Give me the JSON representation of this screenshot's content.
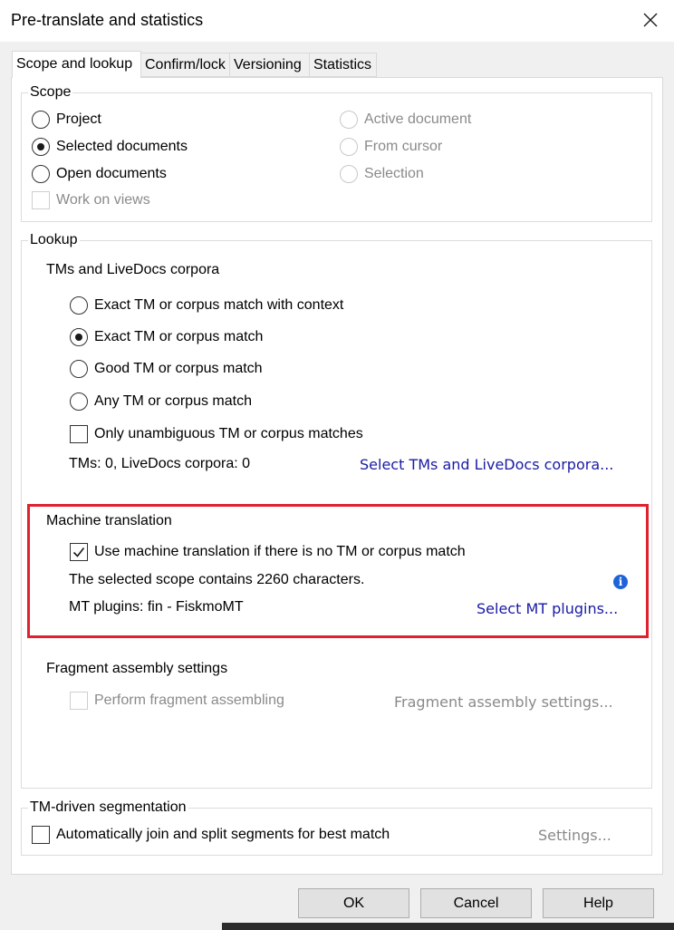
{
  "window": {
    "title": "Pre-translate and statistics"
  },
  "tabs": [
    {
      "label": "Scope and lookup"
    },
    {
      "label": "Confirm/lock"
    },
    {
      "label": "Versioning"
    },
    {
      "label": "Statistics"
    }
  ],
  "scope": {
    "legend": "Scope",
    "options": [
      {
        "label": "Project",
        "checked": false,
        "enabled": true
      },
      {
        "label": "Selected documents",
        "checked": true,
        "enabled": true
      },
      {
        "label": "Open documents",
        "checked": false,
        "enabled": true
      },
      {
        "label": "Active document",
        "checked": false,
        "enabled": false
      },
      {
        "label": "From cursor",
        "checked": false,
        "enabled": false
      },
      {
        "label": "Selection",
        "checked": false,
        "enabled": false
      }
    ],
    "work_on_views": {
      "label": "Work on views",
      "checked": false,
      "enabled": false
    }
  },
  "lookup": {
    "legend": "Lookup",
    "tm_heading": "TMs and LiveDocs corpora",
    "tm_options": [
      {
        "label": "Exact TM or corpus match with context",
        "checked": false
      },
      {
        "label": "Exact TM or corpus match",
        "checked": true
      },
      {
        "label": "Good TM or corpus match",
        "checked": false
      },
      {
        "label": "Any TM or corpus match",
        "checked": false
      }
    ],
    "only_unambiguous": {
      "label": "Only unambiguous TM or corpus matches",
      "checked": false
    },
    "tm_status": "TMs: 0, LiveDocs corpora: 0",
    "select_tms_link": "Select TMs and LiveDocs corpora...",
    "mt": {
      "heading": "Machine translation",
      "use_mt": {
        "label": "Use machine translation if there is no TM or corpus match",
        "checked": true
      },
      "scope_info": "The selected scope contains 2260 characters.",
      "info_icon": "info-icon",
      "plugins_status": "MT plugins: fin - FiskmoMT",
      "select_plugins_link": "Select MT plugins..."
    },
    "fragment": {
      "heading": "Fragment assembly settings",
      "perform": {
        "label": "Perform fragment assembling",
        "checked": false,
        "enabled": false
      },
      "settings_link": "Fragment assembly settings..."
    }
  },
  "segmentation": {
    "legend": "TM-driven segmentation",
    "auto_join": {
      "label": "Automatically join and split segments for best match",
      "checked": false
    },
    "settings_link": "Settings..."
  },
  "buttons": {
    "ok": "OK",
    "cancel": "Cancel",
    "help": "Help"
  },
  "colors": {
    "highlight": "#e0212e",
    "link": "#1a1aa6",
    "info": "#1e64d8",
    "disabled": "#8a8a8a"
  }
}
